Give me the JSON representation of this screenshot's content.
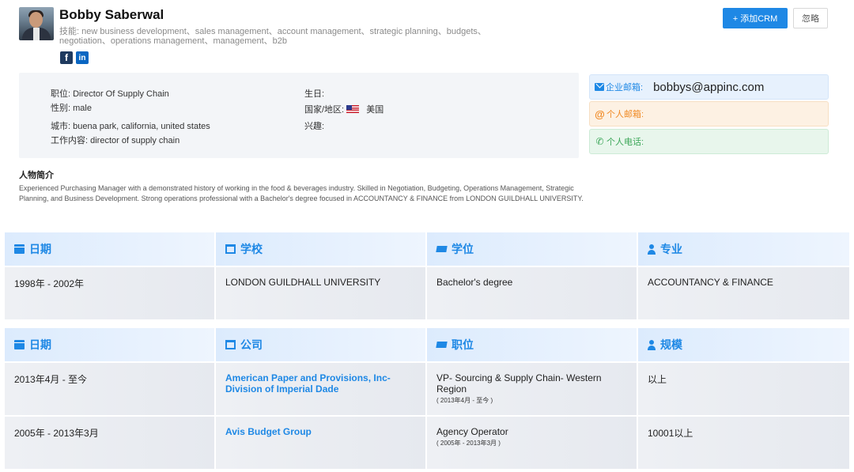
{
  "profile": {
    "name": "Bobby Saberwal",
    "skills": "技能: new business development、sales management、account management、strategic planning、budgets、negotiation、operations management、management、b2b"
  },
  "social": [
    {
      "icon": "facebook-icon",
      "glyph": "f"
    },
    {
      "icon": "linkedin-icon",
      "glyph": "in"
    }
  ],
  "actions": {
    "add_crm": "+ 添加CRM",
    "ignore": "忽略"
  },
  "info": {
    "position": "职位: Director Of Supply Chain",
    "gender": "性别: male",
    "city": "城市: buena park, california, united states",
    "job_content": "工作内容: director of supply chain",
    "birthday": "生日:",
    "country_label": "国家/地区:",
    "country": "美国",
    "interests": "兴趣:"
  },
  "contacts": {
    "work_email_label": "企业邮箱:",
    "work_email": "bobbys@appinc.com",
    "personal_email_label": "个人邮箱:",
    "phone_label": "个人电话:"
  },
  "bio": {
    "title": "人物简介",
    "text": "Experienced Purchasing Manager with a demonstrated history of working in the food & beverages industry. Skilled in Negotiation, Budgeting, Operations Management, Strategic Planning, and Business Development. Strong operations professional with a Bachelor's degree focused in ACCOUNTANCY & FINANCE from LONDON GUILDHALL UNIVERSITY."
  },
  "education": {
    "headers": [
      "日期",
      "学校",
      "学位",
      "专业"
    ],
    "rows": [
      [
        "1998年 - 2002年",
        "LONDON GUILDHALL UNIVERSITY",
        "Bachelor's degree",
        "ACCOUNTANCY & FINANCE"
      ]
    ]
  },
  "work": {
    "headers": [
      "日期",
      "公司",
      "职位",
      "规模"
    ],
    "rows": [
      {
        "date": "2013年4月 - 至今",
        "company": "American Paper and Provisions, Inc-Division of Imperial Dade",
        "title": "VP- Sourcing & Supply Chain- Western Region",
        "period": "( 2013年4月 - 至今 )",
        "size": "以上"
      },
      {
        "date": "2005年 - 2013年3月",
        "company": "Avis Budget Group",
        "title": "Agency Operator",
        "period": "( 2005年 - 2013年3月 )",
        "size": "10001以上"
      }
    ]
  },
  "colors": {
    "accent": "#1e88e5",
    "orange": "#f08a24",
    "green": "#3aa657"
  }
}
